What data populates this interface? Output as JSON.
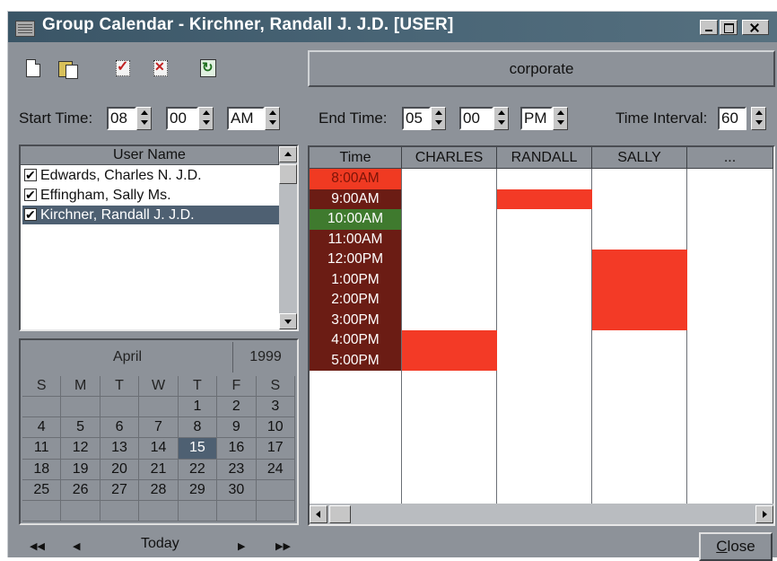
{
  "window": {
    "title": "Group Calendar - Kirchner, Randall J. J.D. [USER]"
  },
  "toolbar": {
    "icons": [
      "new-document-icon",
      "open-document-icon",
      "mark-accept-icon",
      "mark-decline-icon",
      "refresh-icon"
    ],
    "group_label": "corporate"
  },
  "time_settings": {
    "start_label": "Start Time:",
    "start_hour": "08",
    "start_minute": "00",
    "start_ampm": "AM",
    "end_label": "End Time:",
    "end_hour": "05",
    "end_minute": "00",
    "end_ampm": "PM",
    "interval_label": "Time Interval:",
    "interval_value": "60"
  },
  "user_list": {
    "header": "User Name",
    "users": [
      {
        "name": "Edwards, Charles N. J.D.",
        "checked": true,
        "selected": false
      },
      {
        "name": "Effingham, Sally Ms.",
        "checked": true,
        "selected": false
      },
      {
        "name": "Kirchner, Randall J. J.D.",
        "checked": true,
        "selected": true
      }
    ]
  },
  "mini_calendar": {
    "month": "April",
    "year": "1999",
    "weekdays": [
      "S",
      "M",
      "T",
      "W",
      "T",
      "F",
      "S"
    ],
    "weeks": [
      [
        "",
        "",
        "",
        "",
        "1",
        "2",
        "3"
      ],
      [
        "4",
        "5",
        "6",
        "7",
        "8",
        "9",
        "10"
      ],
      [
        "11",
        "12",
        "13",
        "14",
        "15",
        "16",
        "17"
      ],
      [
        "18",
        "19",
        "20",
        "21",
        "22",
        "23",
        "24"
      ],
      [
        "25",
        "26",
        "27",
        "28",
        "29",
        "30",
        ""
      ],
      [
        "",
        "",
        "",
        "",
        "",
        "",
        ""
      ]
    ],
    "today": "15"
  },
  "nav": {
    "first": "◀◀",
    "prev": "◀",
    "today": "Today",
    "next": "▶",
    "last": "▶▶"
  },
  "schedule": {
    "time_header": "Time",
    "columns": [
      "CHARLES",
      "RANDALL",
      "SALLY",
      "..."
    ],
    "slots": [
      {
        "label": "8:00AM",
        "status": "current",
        "color": "#f03a22"
      },
      {
        "label": "9:00AM",
        "status": "busy",
        "color": "#6b1c14"
      },
      {
        "label": "10:00AM",
        "status": "free",
        "color": "#3f7a2e"
      },
      {
        "label": "11:00AM",
        "status": "busy",
        "color": "#6b1c14"
      },
      {
        "label": "12:00PM",
        "status": "busy",
        "color": "#6b1c14"
      },
      {
        "label": "1:00PM",
        "status": "busy",
        "color": "#6b1c14"
      },
      {
        "label": "2:00PM",
        "status": "busy",
        "color": "#6b1c14"
      },
      {
        "label": "3:00PM",
        "status": "busy",
        "color": "#6b1c14"
      },
      {
        "label": "4:00PM",
        "status": "busy",
        "color": "#6b1c14"
      },
      {
        "label": "5:00PM",
        "status": "busy",
        "color": "#6b1c14"
      }
    ],
    "busy_blocks": [
      {
        "column": "CHARLES",
        "start": "4:00PM",
        "end": "6:00PM"
      },
      {
        "column": "RANDALL",
        "start": "9:00AM",
        "end": "10:00AM"
      },
      {
        "column": "SALLY",
        "start": "12:00PM",
        "end": "4:00PM"
      }
    ],
    "busy_color": "#f33a26"
  },
  "footer": {
    "close_label": "Close"
  }
}
